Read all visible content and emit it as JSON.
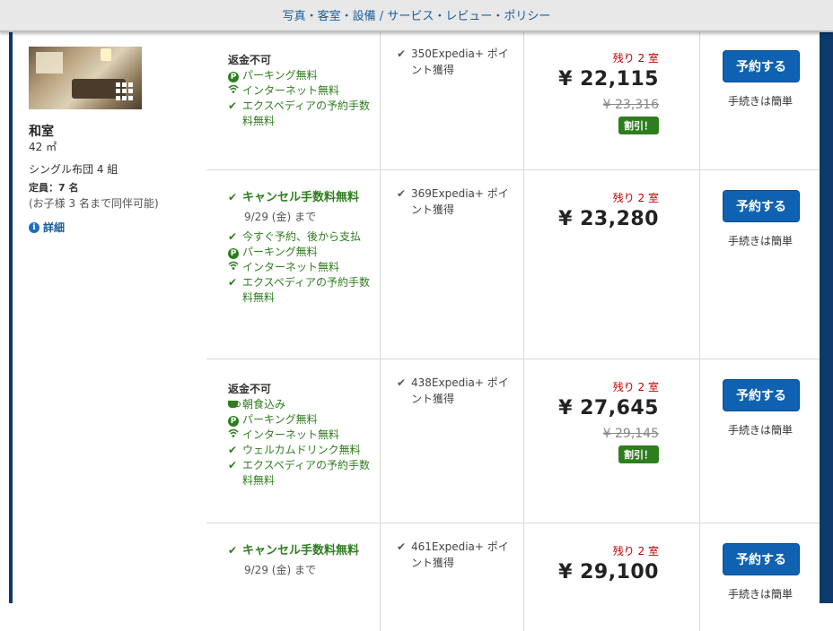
{
  "topbar": {
    "nav": "写真・客室・設備 / サービス・レビュー・ポリシー"
  },
  "room": {
    "name": "和室",
    "size": "42 ㎡",
    "bed": "シングル布団 4 組",
    "capacity": "定員：7 名",
    "kids": "(お子様 3 名まで同伴可能)",
    "details": "詳細",
    "photo_icon": "gallery-icon"
  },
  "rates": [
    {
      "policy": "返金不可",
      "features": [
        {
          "icon": "parking-icon",
          "text": "パーキング無料"
        },
        {
          "icon": "wifi-icon",
          "text": "インターネット無料"
        },
        {
          "icon": "check-icon",
          "text": "エクスペディアの予約手数料無料"
        }
      ],
      "points": "350Expedia+ ポイント獲得",
      "remaining": "残り 2 室",
      "price": "¥ 22,115",
      "old_price": "¥ 23,316",
      "badge": "割引！",
      "book": "予約する",
      "easy": "手続きは簡単"
    },
    {
      "policy_free": "キャンセル手数料無料",
      "policy_date": "9/29 (金) まで",
      "features": [
        {
          "icon": "check-icon",
          "text": "今すぐ予約、後から支払"
        },
        {
          "icon": "parking-icon",
          "text": "パーキング無料"
        },
        {
          "icon": "wifi-icon",
          "text": "インターネット無料"
        },
        {
          "icon": "check-icon",
          "text": "エクスペディアの予約手数料無料"
        }
      ],
      "points": "369Expedia+ ポイント獲得",
      "remaining": "残り 2 室",
      "price": "¥ 23,280",
      "book": "予約する",
      "easy": "手続きは簡単"
    },
    {
      "policy": "返金不可",
      "features": [
        {
          "icon": "breakfast-icon",
          "text": "朝食込み"
        },
        {
          "icon": "parking-icon",
          "text": "パーキング無料"
        },
        {
          "icon": "wifi-icon",
          "text": "インターネット無料"
        },
        {
          "icon": "check-icon",
          "text": "ウェルカムドリンク無料"
        },
        {
          "icon": "check-icon",
          "text": "エクスペディアの予約手数料無料"
        }
      ],
      "points": "438Expedia+ ポイント獲得",
      "remaining": "残り 2 室",
      "price": "¥ 27,645",
      "old_price": "¥ 29,145",
      "badge": "割引！",
      "book": "予約する",
      "easy": "手続きは簡単"
    },
    {
      "policy_free": "キャンセル手数料無料",
      "policy_date": "9/29 (金) まで",
      "features": [],
      "points": "461Expedia+ ポイント獲得",
      "remaining": "残り 2 室",
      "price": "¥ 29,100",
      "book": "予約する",
      "easy": "手続きは簡単"
    }
  ],
  "colors": {
    "brand_blue": "#0f62b1",
    "frame": "#0b3a6b",
    "green": "#2e7d1e",
    "red": "#c00000"
  }
}
